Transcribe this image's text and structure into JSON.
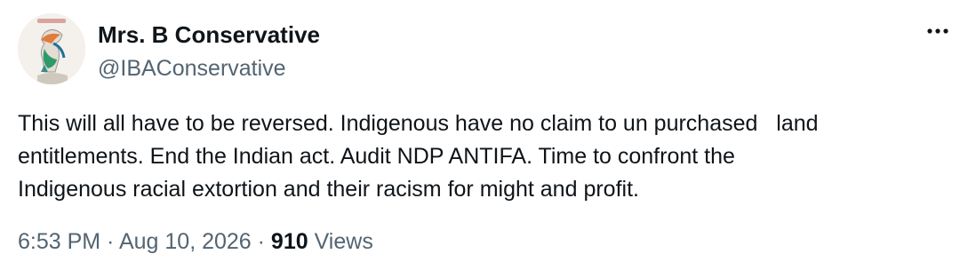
{
  "tweet": {
    "author": {
      "display_name": "Mrs. B Conservative",
      "handle": "@IBAConservative",
      "avatar_icon": "profile-avatar"
    },
    "more_icon": "more-options-icon",
    "text": "This will all have to be reversed. Indigenous have no claim to un purchased   land\nentitlements. End the Indian act. Audit NDP ANTIFA. Time to confront the\nIndigenous racial extortion and their racism for might and profit.",
    "meta": {
      "time": "6:53 PM",
      "separator_1": " · ",
      "date": "Aug 10, 2026",
      "separator_2": " · ",
      "views_count": "910",
      "views_label": " Views"
    }
  },
  "colors": {
    "primary_text": "#0f1419",
    "secondary_text": "#536471",
    "background": "#ffffff"
  }
}
